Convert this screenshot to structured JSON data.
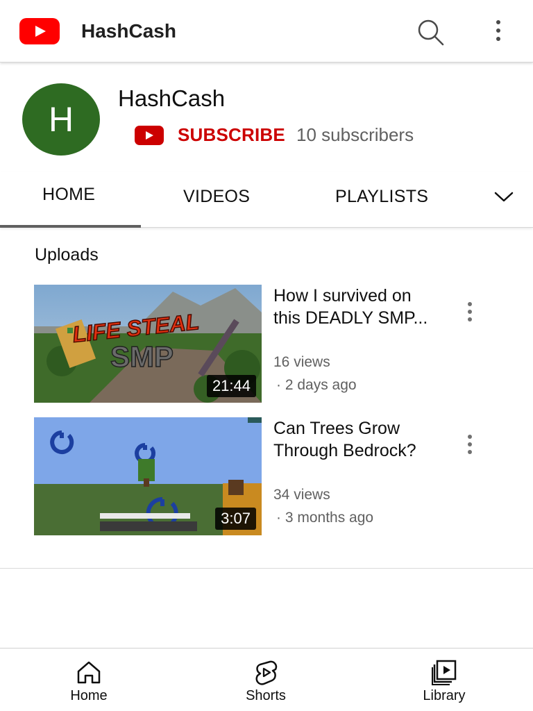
{
  "app": {
    "title": "HashCash",
    "brand_color": "#ff0000",
    "icons": {
      "logo": "youtube-logo-icon",
      "search": "search-icon",
      "more": "more-vert-icon"
    }
  },
  "channel": {
    "avatar_letter": "H",
    "avatar_color": "#2e6b22",
    "name": "HashCash",
    "subscribe_label": "SUBSCRIBE",
    "subscribe_color": "#cc0000",
    "subscribers": "10 subscribers"
  },
  "tabs": [
    {
      "label": "HOME",
      "selected": true
    },
    {
      "label": "VIDEOS",
      "selected": false
    },
    {
      "label": "PLAYLISTS",
      "selected": false
    }
  ],
  "tabs_more_icon": "chevron-down-icon",
  "uploads": {
    "title": "Uploads",
    "videos": [
      {
        "title": "How I survived on this DEADLY SMP...",
        "thumbnail_text": [
          "LIFE STEAL",
          "SMP"
        ],
        "duration": "21:44",
        "views": "16 views",
        "age": "· 2 days ago"
      },
      {
        "title": "Can Trees Grow Through Bedrock?",
        "duration": "3:07",
        "views": "34 views",
        "age": "· 3 months ago"
      }
    ]
  },
  "bottom_nav": [
    {
      "label": "Home",
      "icon": "home-icon"
    },
    {
      "label": "Shorts",
      "icon": "shorts-icon"
    },
    {
      "label": "Library",
      "icon": "library-icon"
    }
  ]
}
